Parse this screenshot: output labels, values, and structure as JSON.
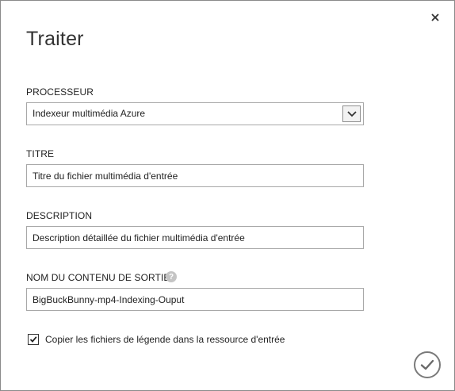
{
  "dialog": {
    "title": "Traiter"
  },
  "fields": {
    "processor": {
      "label": "PROCESSEUR",
      "value": "Indexeur multimédia Azure"
    },
    "title": {
      "label": "TITRE",
      "value": "Titre du fichier multimédia d'entrée"
    },
    "description": {
      "label": "DESCRIPTION",
      "value": "Description détaillée du fichier multimédia d'entrée"
    },
    "output_name": {
      "label": "NOM DU CONTENU DE SORTIE",
      "value": "BigBuckBunny-mp4-Indexing-Ouput",
      "help_glyph": "?"
    }
  },
  "options": {
    "copy_captions_label": "Copier les fichiers de légende dans la ressource d'entrée",
    "copy_captions_checked": true
  },
  "icons": {
    "close": "close-icon",
    "dropdown": "chevron-down-icon",
    "help": "help-icon",
    "checkmark": "checkmark-icon",
    "confirm": "confirm-check-icon"
  }
}
